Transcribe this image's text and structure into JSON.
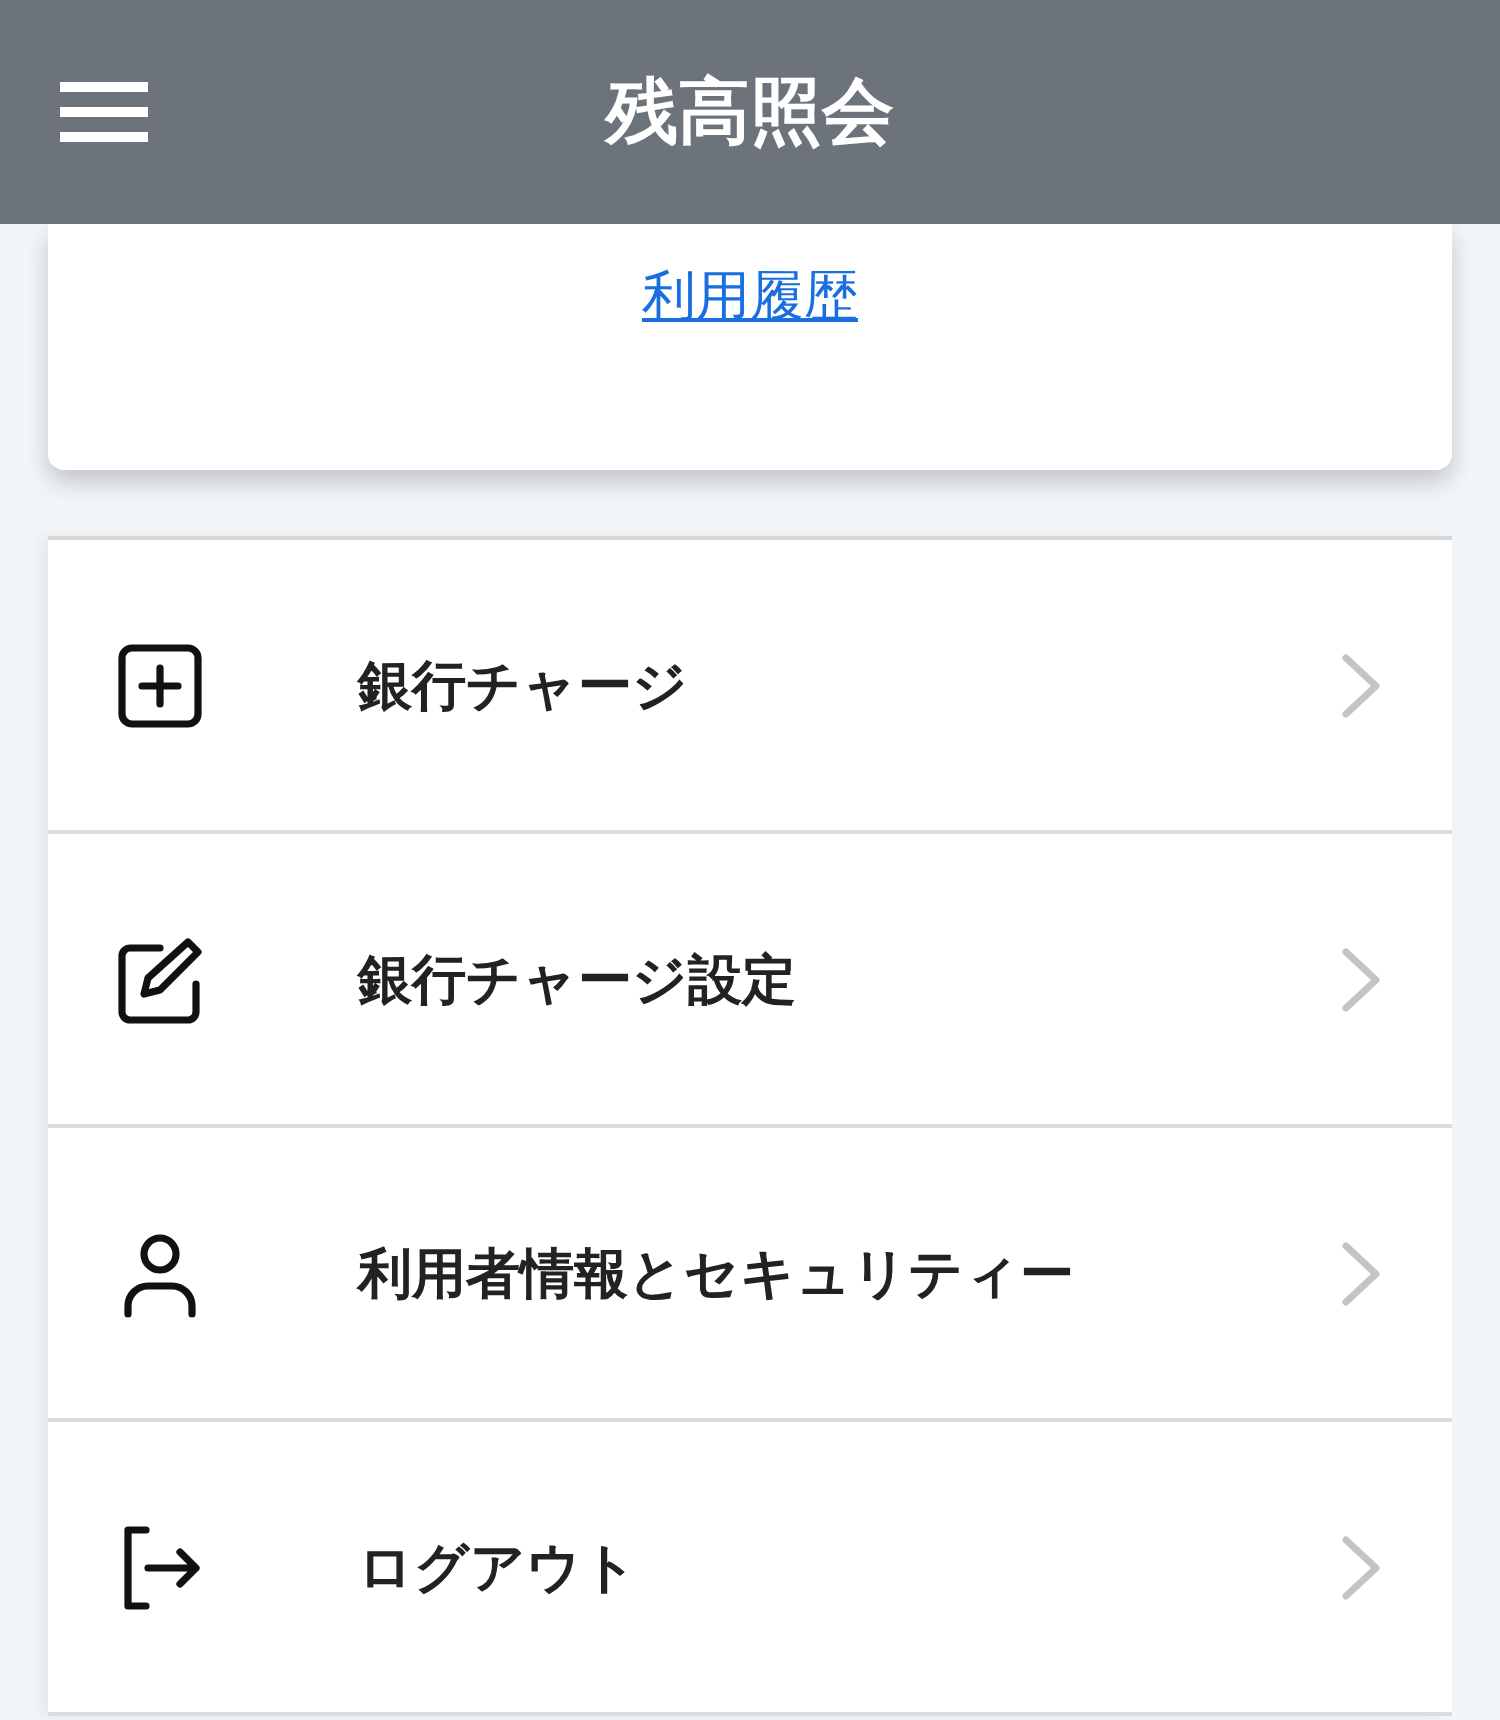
{
  "header": {
    "title": "残高照会"
  },
  "card": {
    "link": "利用履歴"
  },
  "menu": [
    {
      "kind": "add",
      "label": "銀行チャージ"
    },
    {
      "kind": "edit",
      "label": "銀行チャージ設定"
    },
    {
      "kind": "user",
      "label": "利用者情報とセキュリティー"
    },
    {
      "kind": "logout",
      "label": "ログアウト"
    }
  ]
}
